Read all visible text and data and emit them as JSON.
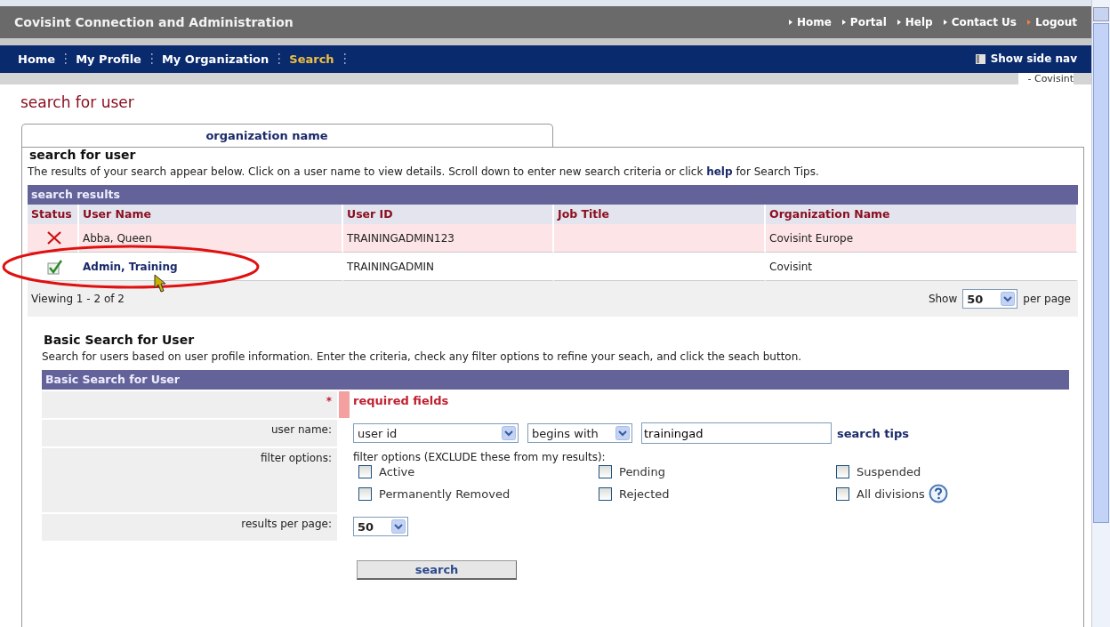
{
  "header": {
    "title": "Covisint Connection and Administration",
    "links": [
      "Home",
      "Portal",
      "Help",
      "Contact Us",
      "Logout"
    ]
  },
  "nav": {
    "items": [
      {
        "label": "Home",
        "selected": false
      },
      {
        "label": "My Profile",
        "selected": false
      },
      {
        "label": "My Organization",
        "selected": false
      },
      {
        "label": "Search",
        "selected": true
      }
    ],
    "side_nav": "Show side nav"
  },
  "breadcrumb": "- Covisint",
  "page_title": "search for user",
  "tab": {
    "label": "organization name"
  },
  "results": {
    "heading": "search for user",
    "description": "The results of your search appear below. Click on a user name to view details. Scroll down to enter new search criteria or click **help** for Search Tips.",
    "title": "search results",
    "columns": [
      "Status",
      "User Name",
      "User ID",
      "Job Title",
      "Organization Name"
    ],
    "rows": [
      {
        "kind": "cross",
        "user_name": "Abba, Queen",
        "user_id": "TRAININGADMIN123",
        "job_title": "",
        "organization": "Covisint Europe"
      },
      {
        "kind": "check",
        "user_name": "Admin, Training",
        "user_id": "TRAININGADMIN",
        "job_title": "",
        "organization": "Covisint"
      }
    ],
    "viewing": "Viewing 1 - 2 of 2",
    "show_label": "Show",
    "per_page_value": "50",
    "per_page_label": "per page"
  },
  "basic_search": {
    "heading": "Basic Search for User",
    "description": "Search for users based on user profile information. Enter the criteria, check any filter options to refine your seach, and click the seach button.",
    "title": "Basic Search for User",
    "required_mark": "*",
    "required_text": "required fields",
    "user_name_label": "user name:",
    "field_select": "user id",
    "match_select": "begins with",
    "value": "trainingad",
    "tips_link": "search tips",
    "filter_label": "filter options:",
    "filter_caption": "filter options (EXCLUDE these from my results):",
    "filters": [
      {
        "label": "Active",
        "checked": false
      },
      {
        "label": "Pending",
        "checked": false
      },
      {
        "label": "Suspended",
        "checked": false
      },
      {
        "label": "Permanently Removed",
        "checked": false
      },
      {
        "label": "Rejected",
        "checked": false
      },
      {
        "label": "All divisions",
        "checked": false,
        "help": true
      }
    ],
    "results_label": "results per page:",
    "results_value": "50",
    "button": "search"
  }
}
